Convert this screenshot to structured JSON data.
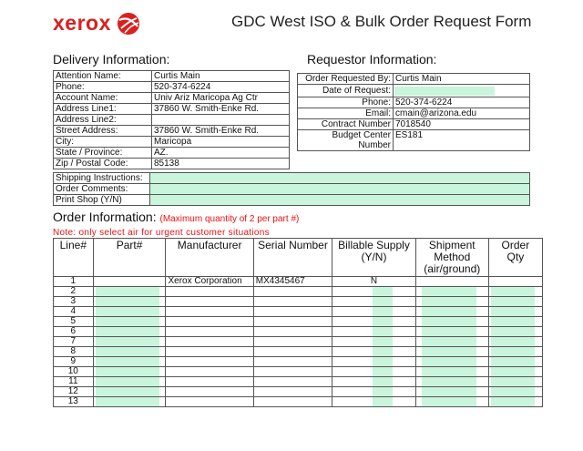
{
  "header": {
    "logo_text": "xerox",
    "title": "GDC West ISO & Bulk Order Request Form"
  },
  "colors": {
    "brand_red": "#d8211f",
    "input_green": "#c9f5dd",
    "note_red": "#e11111"
  },
  "delivery": {
    "heading": "Delivery Information:",
    "rows": [
      {
        "label": "Attention Name:",
        "value": "Curtis Main"
      },
      {
        "label": "Phone:",
        "value": "520-374-6224"
      },
      {
        "label": "Account Name:",
        "value": "Univ Ariz Maricopa Ag Ctr"
      },
      {
        "label": "Address Line1:",
        "value": "37860 W. Smith-Enke Rd."
      },
      {
        "label": "Address Line2:",
        "value": ""
      },
      {
        "label": "Street Address:",
        "value": "37860 W. Smith-Enke Rd."
      },
      {
        "label": "City:",
        "value": "Maricopa"
      },
      {
        "label": "State / Province:",
        "value": "AZ."
      },
      {
        "label": "Zip / Postal Code:",
        "value": "85138"
      }
    ]
  },
  "requestor": {
    "heading": "Requestor Information:",
    "rows": [
      {
        "label": "Order Requested By:",
        "value": "Curtis Main"
      },
      {
        "label": "Date of Request:",
        "value": ""
      },
      {
        "label": "Phone:",
        "value": "520-374-6224"
      },
      {
        "label": "Email:",
        "value": "cmain@arizona.edu"
      },
      {
        "label": "Contract Number",
        "value": "7018540"
      },
      {
        "label": "Budget Center Number",
        "value": "ES181"
      }
    ]
  },
  "shipping": {
    "rows": [
      {
        "label": "Shipping Instructions:",
        "value": ""
      },
      {
        "label": "Order Comments:",
        "value": ""
      },
      {
        "label": "Print Shop (Y/N)",
        "value": ""
      }
    ]
  },
  "order": {
    "heading": "Order Information:",
    "heading_note": "(Maximum quantity of 2 per part #)",
    "note": "Note: only select air for urgent customer situations",
    "columns": [
      "Line#",
      "Part#",
      "Manufacturer",
      "Serial Number",
      "Billable Supply (Y/N)",
      "Shipment Method (air/ground)",
      "Order Qty"
    ],
    "rows": [
      {
        "line": "1",
        "part": "",
        "manufacturer": "Xerox Corporation",
        "serial": "MX4345467",
        "billable": "N",
        "shipment": "",
        "qty": ""
      },
      {
        "line": "2"
      },
      {
        "line": "3"
      },
      {
        "line": "4"
      },
      {
        "line": "5"
      },
      {
        "line": "6"
      },
      {
        "line": "7"
      },
      {
        "line": "8"
      },
      {
        "line": "9"
      },
      {
        "line": "10"
      },
      {
        "line": "11"
      },
      {
        "line": "12"
      },
      {
        "line": "13"
      }
    ]
  }
}
